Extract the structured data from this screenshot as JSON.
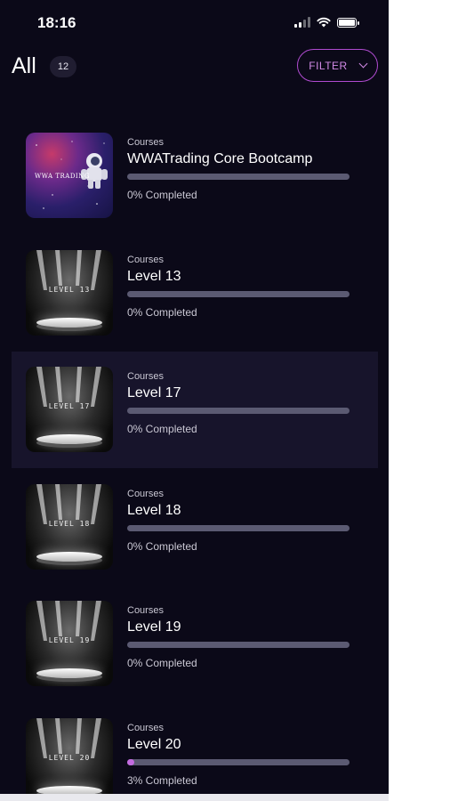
{
  "status_bar": {
    "time": "18:16"
  },
  "header": {
    "title": "All",
    "count": "12",
    "filter_label": "FILTER"
  },
  "courses": [
    {
      "category": "Courses",
      "title": "WWATrading Core Bootcamp",
      "status": "0% Completed",
      "progress": 0,
      "thumb": {
        "type": "space",
        "text": "WWA TRADING"
      }
    },
    {
      "category": "Courses",
      "title": "Level 13",
      "status": "0% Completed",
      "progress": 0,
      "thumb": {
        "type": "level",
        "text": "LEVEL 13"
      }
    },
    {
      "category": "Courses",
      "title": "Level 17",
      "status": "0% Completed",
      "progress": 0,
      "thumb": {
        "type": "level",
        "text": "LEVEL 17"
      }
    },
    {
      "category": "Courses",
      "title": "Level 18",
      "status": "0% Completed",
      "progress": 0,
      "thumb": {
        "type": "level",
        "text": "LEVEL 18"
      }
    },
    {
      "category": "Courses",
      "title": "Level 19",
      "status": "0% Completed",
      "progress": 0,
      "thumb": {
        "type": "level",
        "text": "LEVEL 19"
      }
    },
    {
      "category": "Courses",
      "title": "Level 20",
      "status": "3% Completed",
      "progress": 3,
      "thumb": {
        "type": "level",
        "text": "LEVEL 20"
      }
    }
  ],
  "colors": {
    "background": "#0b0918",
    "accent": "#c36be0",
    "track": "#5b5a72",
    "highlight_row": "#17142b"
  }
}
